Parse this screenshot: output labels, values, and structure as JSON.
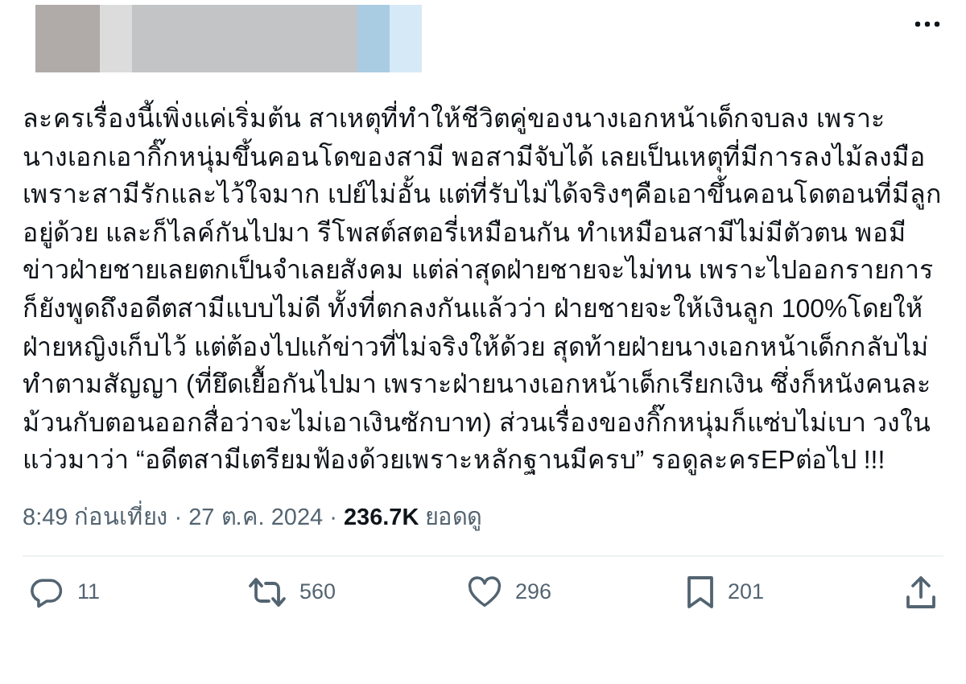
{
  "post": {
    "text": "ละครเรื่องนี้เพิ่งแค่เริ่มต้น สาเหตุที่ทำให้ชีวิตคู่ของนางเอกหน้าเด็กจบลง เพราะนางเอกเอากิ๊กหนุ่มขึ้นคอนโดของสามี พอสามีจับได้ เลยเป็นเหตุที่มีการลงไม้ลงมือ เพราะสามีรักและไว้ใจมาก เปย์ไม่อั้น แต่ที่รับไม่ได้จริงๆคือเอาขึ้นคอนโดตอนที่มีลูกอยู่ด้วย และก็ไลค์กันไปมา รีโพสต์สตอรี่เหมือนกัน ทำเหมือนสามีไม่มีตัวตน พอมีข่าวฝ่ายชายเลยตกเป็นจำเลยสังคม แต่ล่าสุดฝ่ายชายจะไม่ทน เพราะไปออกรายการก็ยังพูดถึงอดีตสามีแบบไม่ดี ทั้งที่ตกลงกันแล้วว่า ฝ่ายชายจะให้เงินลูก 100%โดยให้ฝ่ายหญิงเก็บไว้ แต่ต้องไปแก้ข่าวที่ไม่จริงให้ด้วย สุดท้ายฝ่ายนางเอกหน้าเด็กกลับไม่ทำตามสัญญา (ที่ยึดเยื้อกันไปมา เพราะฝ่ายนางเอกหน้าเด็กเรียกเงิน ซึ่งก็หนังคนละม้วนกับตอนออกสื่อว่าจะไม่เอาเงินซักบาท) ส่วนเรื่องของกิ๊กหนุ่มก็แซ่บไม่เบา วงในแว่วมาว่า “อดีตสามีเตรียมฟ้องด้วยเพราะหลักฐานมีครบ” รอดูละครEPต่อไป !!!",
    "time": "8:49 ก่อนเที่ยง",
    "separator": "·",
    "date": "27 ต.ค. 2024",
    "views": "236.7K",
    "views_label": "ยอดดู"
  },
  "actions": [
    {
      "kind": "reply",
      "count": "11"
    },
    {
      "kind": "repost",
      "count": "560"
    },
    {
      "kind": "like",
      "count": "296"
    },
    {
      "kind": "bookmark",
      "count": "201"
    },
    {
      "kind": "share"
    }
  ]
}
